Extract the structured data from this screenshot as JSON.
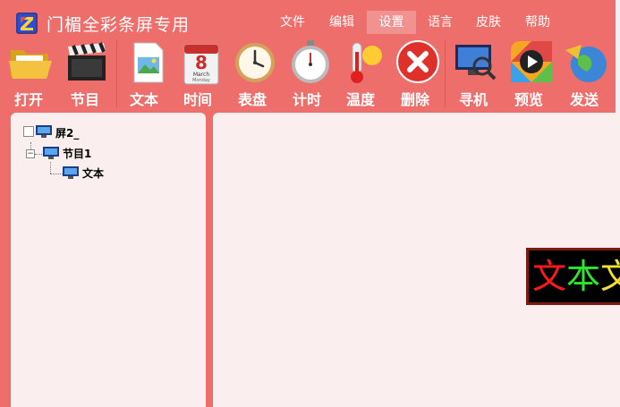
{
  "app": {
    "title": "门楣全彩条屏专用"
  },
  "menu": [
    {
      "label": "文件"
    },
    {
      "label": "编辑"
    },
    {
      "label": "设置"
    },
    {
      "label": "语言"
    },
    {
      "label": "皮肤"
    },
    {
      "label": "帮助"
    }
  ],
  "toolbar": [
    {
      "label": "打开",
      "icon": "folder-icon"
    },
    {
      "label": "节目",
      "icon": "clapperboard-icon"
    },
    {
      "label": "文本",
      "icon": "text-document-icon"
    },
    {
      "label": "时间",
      "icon": "calendar-icon"
    },
    {
      "label": "表盘",
      "icon": "clock-icon"
    },
    {
      "label": "计时",
      "icon": "stopwatch-icon"
    },
    {
      "label": "温度",
      "icon": "thermometer-icon"
    },
    {
      "label": "删除",
      "icon": "delete-icon"
    },
    {
      "label": "寻机",
      "icon": "monitor-search-icon"
    },
    {
      "label": "预览",
      "icon": "play-icon"
    },
    {
      "label": "发送",
      "icon": "send-globe-icon"
    }
  ],
  "calendar_icon": {
    "day": "8",
    "month": "March",
    "weekday": "Monday"
  },
  "tree": {
    "screen": "屏2_",
    "program": "节目1",
    "item": "文本"
  },
  "preview": {
    "chars": [
      "文",
      "本",
      "文"
    ],
    "colors": [
      "#ff1a1a",
      "#2ee62e",
      "#f0e030"
    ]
  }
}
